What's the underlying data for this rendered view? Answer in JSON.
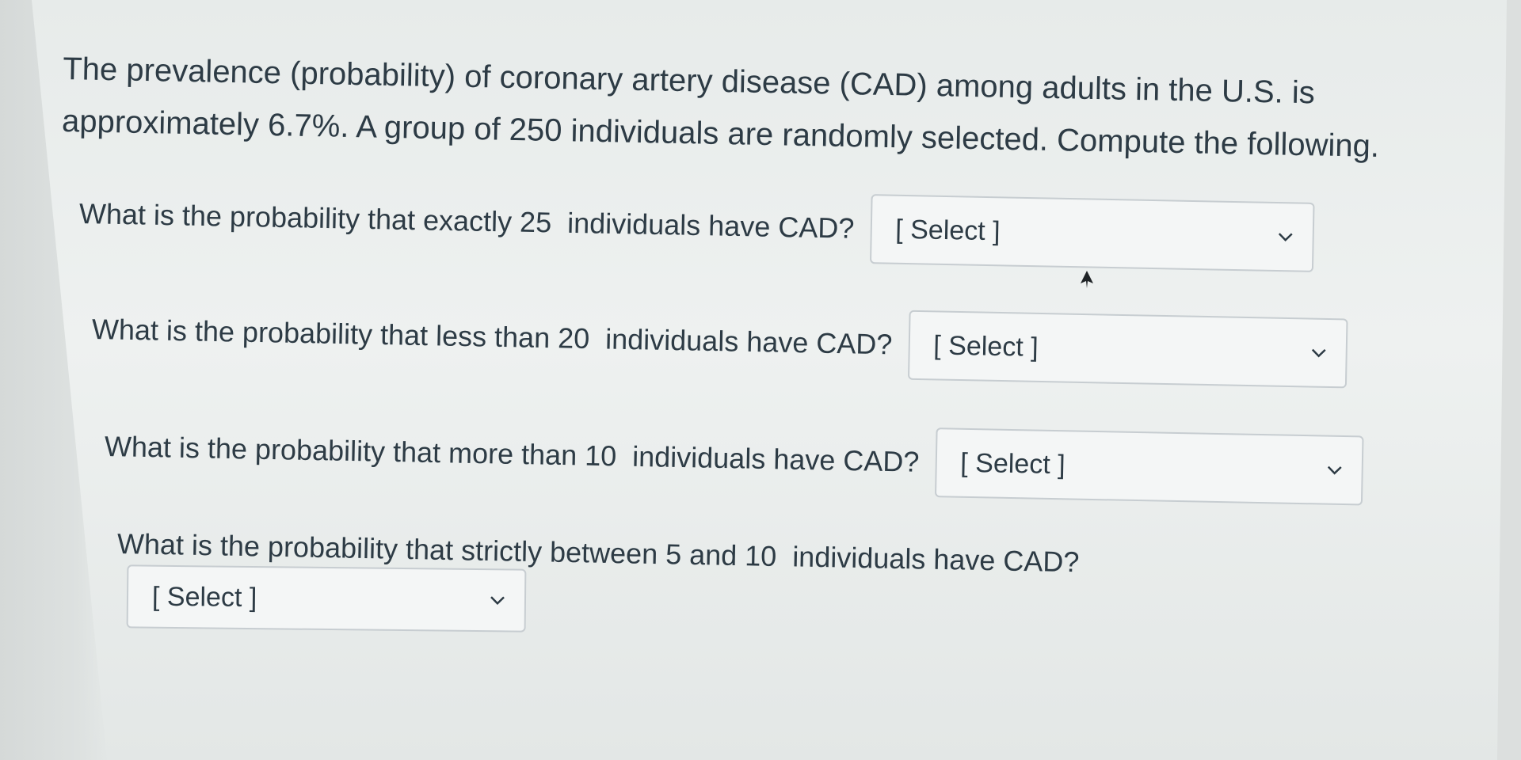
{
  "intro_text": "The prevalence (probability) of coronary artery disease (CAD) among adults in the U.S. is approximately 6.7%. A group of 250 individuals are randomly selected. Compute the following.",
  "questions": [
    {
      "text": "What is the probability that exactly 25  individuals have CAD?",
      "select_value": "[ Select ]"
    },
    {
      "text": "What is the probability that less than 20  individuals have CAD?",
      "select_value": "[ Select ]"
    },
    {
      "text": "What is the probability that more than 10  individuals have CAD?",
      "select_value": "[ Select ]"
    },
    {
      "text": "What is the probability that strictly between 5 and 10  individuals have CAD?",
      "select_value": "[ Select ]"
    }
  ],
  "icons": {
    "dropdown": "chevron-down-icon",
    "pointer": "mouse-cursor-icon"
  },
  "colors": {
    "text": "#2d3b45",
    "select_border": "#c7cdd1",
    "select_bg": "#f4f6f6",
    "page_bg": "#eef1f0"
  }
}
